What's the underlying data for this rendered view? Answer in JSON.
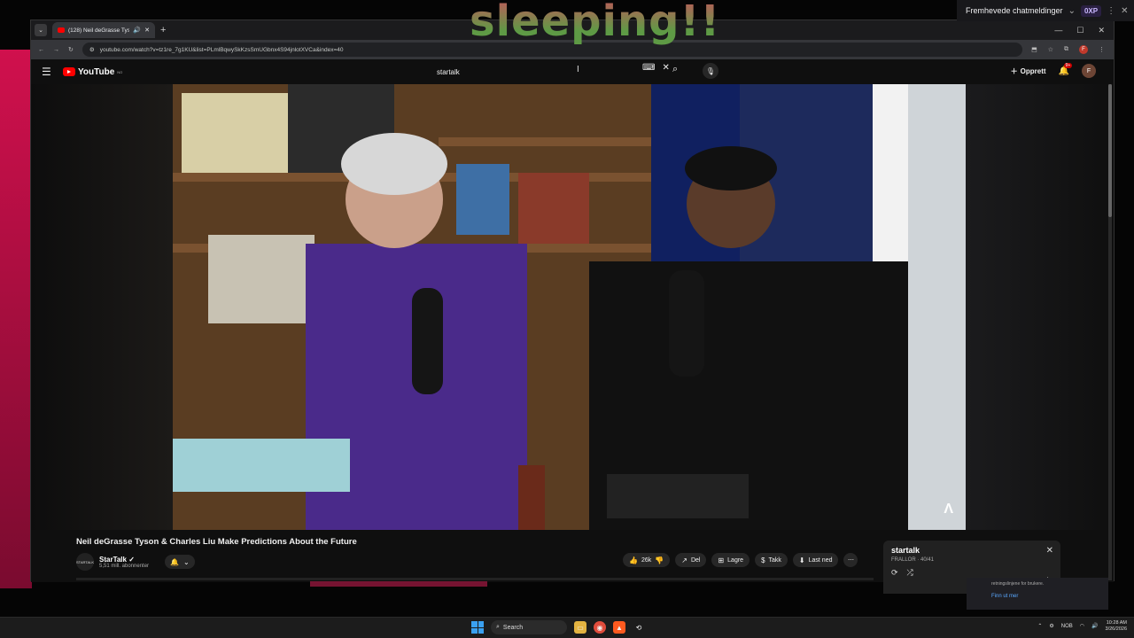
{
  "overlay": {
    "text": "sleeping!!"
  },
  "chat_header": {
    "label": "Fremhevede chatmeldinger",
    "xp_badge": "0XP"
  },
  "browser": {
    "tab_title": "(128) Neil deGrasse Tyson",
    "url": "youtube.com/watch?v=tz1re_7g1KU&list=PLmlBqwySkKzsSmUGbnx4S94jnlotXVCa&index=40"
  },
  "youtube": {
    "logo_text": "YouTube",
    "logo_country": "NO",
    "search_value": "startalk",
    "create_label": "Opprett",
    "notif_count": "9+",
    "avatar_letter": "F"
  },
  "video": {
    "title": "Neil deGrasse Tyson & Charles Liu Make Predictions About the Future",
    "channel_name": "StarTalk",
    "channel_logo_text": "STARTALK",
    "subscribers": "5,51 mill. abonnenter",
    "actions": {
      "like_count": "26k",
      "share_label": "Del",
      "save_label": "Lagre",
      "thanks_label": "Takk",
      "download_label": "Last ned"
    }
  },
  "playlist": {
    "title": "startalk",
    "subtitle": "FRALLOR · 40/41"
  },
  "notif_peek": {
    "line": "retningslinjene for brukere.",
    "link": "Finn ut mer"
  },
  "taskbar": {
    "search_label": "Search",
    "lang": "NOB",
    "time": "10:28 AM",
    "date": "3/26/2026"
  },
  "colors": {
    "yt_red": "#ff0000",
    "accent_pink": "#d0104d",
    "bg": "#0f0f0f"
  }
}
